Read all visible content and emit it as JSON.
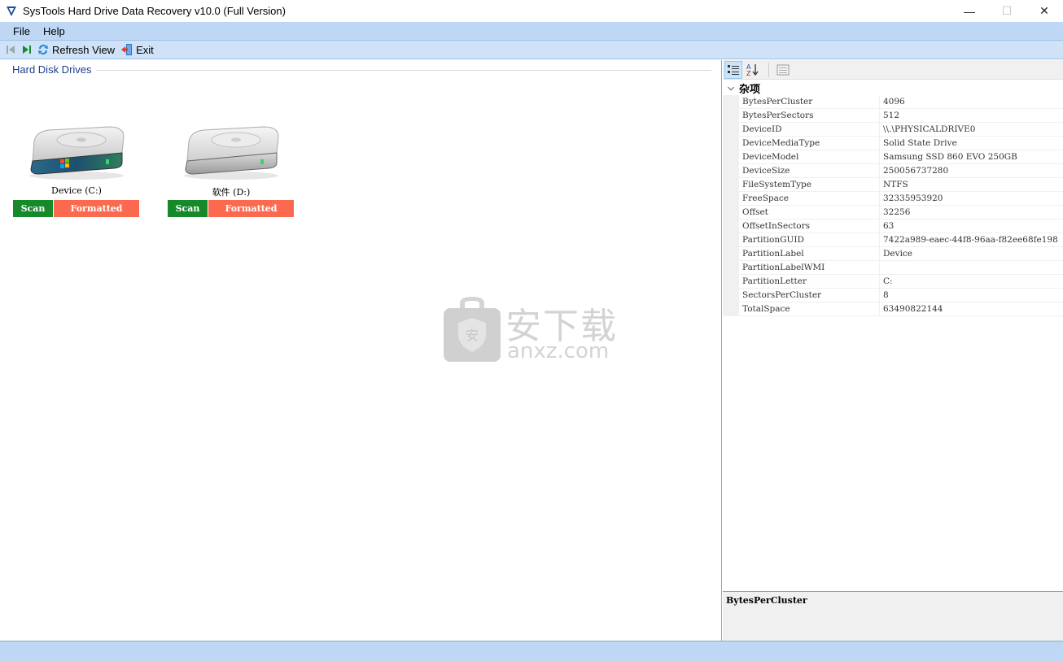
{
  "window": {
    "title": "SysTools Hard Drive Data Recovery v10.0 (Full Version)",
    "minimize": "—",
    "maximize": "☐",
    "close": "✕"
  },
  "menu": {
    "file": "File",
    "help": "Help"
  },
  "toolbar": {
    "refresh_label": "Refresh View",
    "exit_label": "Exit"
  },
  "main": {
    "group_title": "Hard Disk Drives",
    "drives": [
      {
        "label": "Device (C:)",
        "scan": "Scan",
        "formatted": "Formatted",
        "icon": "windows-hard-drive-icon"
      },
      {
        "label": "软件 (D:)",
        "scan": "Scan",
        "formatted": "Formatted",
        "icon": "hard-drive-icon"
      }
    ]
  },
  "watermark": {
    "cn": "安下载",
    "en": "anxz.com"
  },
  "properties": {
    "category": "杂项",
    "rows": [
      {
        "name": "BytesPerCluster",
        "value": "4096"
      },
      {
        "name": "BytesPerSectors",
        "value": "512"
      },
      {
        "name": "DeviceID",
        "value": "\\\\.\\PHYSICALDRIVE0"
      },
      {
        "name": "DeviceMediaType",
        "value": "Solid State Drive"
      },
      {
        "name": "DeviceModel",
        "value": "Samsung SSD 860 EVO 250GB"
      },
      {
        "name": "DeviceSize",
        "value": "250056737280"
      },
      {
        "name": "FileSystemType",
        "value": "NTFS"
      },
      {
        "name": "FreeSpace",
        "value": "32335953920"
      },
      {
        "name": "Offset",
        "value": "32256"
      },
      {
        "name": "OffsetInSectors",
        "value": "63"
      },
      {
        "name": "PartitionGUID",
        "value": "7422a989-eaec-44f8-96aa-f82ee68fe198"
      },
      {
        "name": "PartitionLabel",
        "value": "Device"
      },
      {
        "name": "PartitionLabelWMI",
        "value": ""
      },
      {
        "name": "PartitionLetter",
        "value": "C:"
      },
      {
        "name": "SectorsPerCluster",
        "value": "8"
      },
      {
        "name": "TotalSpace",
        "value": "63490822144"
      }
    ],
    "description_title": "BytesPerCluster"
  },
  "colors": {
    "menubar": "#bdd7f5",
    "scan_button": "#168a2a",
    "formatted_button": "#fb6a4f",
    "group_title": "#1e3f8a"
  }
}
